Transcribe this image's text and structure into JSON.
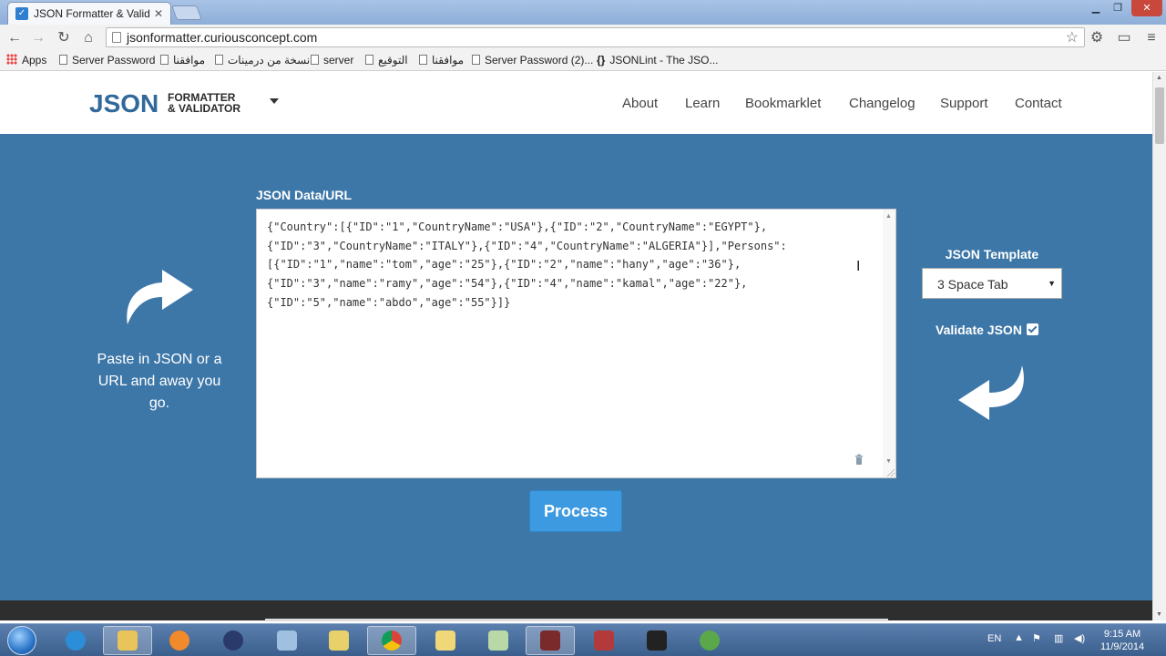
{
  "browser": {
    "tab_title": "JSON Formatter & Validat",
    "url": "jsonformatter.curiousconcept.com",
    "bookmarks": [
      {
        "label": "Apps"
      },
      {
        "label": "Server Password"
      },
      {
        "label": "موافقنا"
      },
      {
        "label": "نسخة من درمينات"
      },
      {
        "label": "server"
      },
      {
        "label": "التوقيع"
      },
      {
        "label": "موافقنا"
      },
      {
        "label": "Server Password (2)..."
      },
      {
        "label": "JSONLint - The JSO..."
      }
    ]
  },
  "site": {
    "logo_main": "JSON",
    "logo_line1": "FORMATTER",
    "logo_line2": "& VALIDATOR",
    "nav": [
      "About",
      "Learn",
      "Bookmarklet",
      "Changelog",
      "Support",
      "Contact"
    ]
  },
  "main": {
    "data_label": "JSON Data/URL",
    "editor_content": "{\"Country\":[{\"ID\":\"1\",\"CountryName\":\"USA\"},{\"ID\":\"2\",\"CountryName\":\"EGYPT\"},\n{\"ID\":\"3\",\"CountryName\":\"ITALY\"},{\"ID\":\"4\",\"CountryName\":\"ALGERIA\"}],\"Persons\":\n[{\"ID\":\"1\",\"name\":\"tom\",\"age\":\"25\"},{\"ID\":\"2\",\"name\":\"hany\",\"age\":\"36\"},\n{\"ID\":\"3\",\"name\":\"ramy\",\"age\":\"54\"},{\"ID\":\"4\",\"name\":\"kamal\",\"age\":\"22\"},\n{\"ID\":\"5\",\"name\":\"abdo\",\"age\":\"55\"}]}",
    "paste_hint": "Paste in JSON or a URL and away you go.",
    "template_label": "JSON Template",
    "template_value": "3 Space Tab",
    "validate_label": "Validate JSON",
    "validate_checked": true,
    "process_label": "Process"
  },
  "taskbar": {
    "language": "EN",
    "time": "9:15 AM",
    "date": "11/9/2014"
  },
  "colors": {
    "main_blue": "#3d77a8",
    "logo_blue": "#30699a",
    "button_blue": "#3d9ae0"
  }
}
